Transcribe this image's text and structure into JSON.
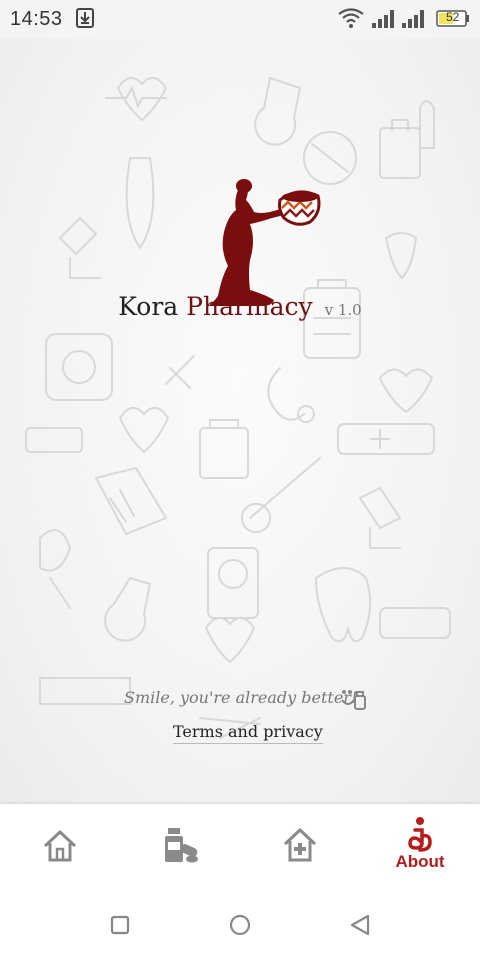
{
  "status_bar": {
    "time": "14:53",
    "battery_level": "52",
    "icons": [
      "download-icon",
      "wifi-icon",
      "signal-icon",
      "signal-icon",
      "battery-icon"
    ]
  },
  "app": {
    "name_part1": "Kora",
    "name_part2": "Pharmacy",
    "version": "v 1.0",
    "tagline": "Smile, you're already better!",
    "terms_link": "Terms and privacy"
  },
  "bottom_nav": {
    "items": [
      {
        "icon": "home-icon",
        "label": ""
      },
      {
        "icon": "medicine-icon",
        "label": ""
      },
      {
        "icon": "pharmacy-icon",
        "label": ""
      },
      {
        "icon": "info-icon",
        "label": "About",
        "active": true
      }
    ]
  },
  "system_nav": {
    "buttons": [
      "recent-apps-icon",
      "home-circle-icon",
      "back-icon"
    ]
  },
  "colors": {
    "brand": "#6f1414",
    "active": "#b71c1c",
    "inactive_icon": "#8a8a8a"
  }
}
